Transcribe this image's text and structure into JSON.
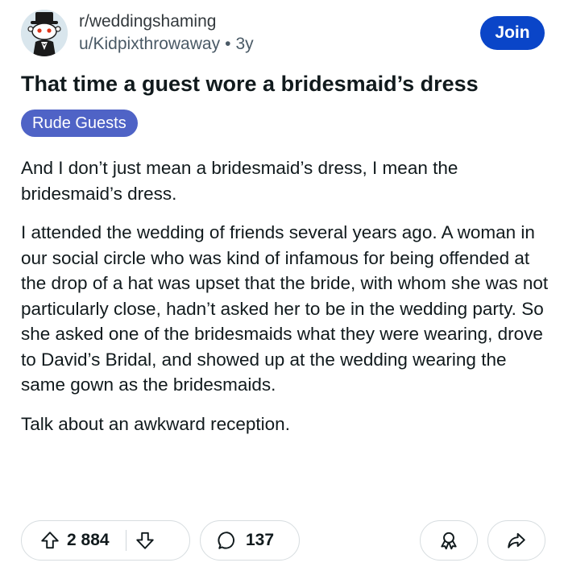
{
  "header": {
    "subreddit": "r/weddingshaming",
    "username": "u/Kidpixthrowaway",
    "separator": "•",
    "age": "3y",
    "join_label": "Join"
  },
  "post": {
    "title": "That time a guest wore a bridesmaid’s dress",
    "flair": "Rude Guests",
    "paragraphs": [
      "And I don’t just mean a bridesmaid’s dress, I mean the bridesmaid’s dress.",
      "I attended the wedding of friends several years ago. A woman in our social circle who was kind of infamous for being offended at the drop of a hat was upset that the bride, with whom she was not particularly close, hadn’t asked her to be in the wedding party. So she asked one of the bridesmaids what they were wearing, drove to David’s Bridal, and showed up at the wedding wearing the same gown as the bridesmaids.",
      "Talk about an awkward reception."
    ]
  },
  "actions": {
    "upvote_count": "2 884",
    "comment_count": "137"
  },
  "colors": {
    "join_button": "#0a45c8",
    "flair_bg": "#4f63c6",
    "border": "#d7dde0"
  },
  "icons": {
    "avatar": "snoo-tuxedo-avatar",
    "upvote": "arrow-up-icon",
    "downvote": "arrow-down-icon",
    "comment": "speech-bubble-icon",
    "award": "award-ribbon-icon",
    "share": "share-arrow-icon"
  }
}
